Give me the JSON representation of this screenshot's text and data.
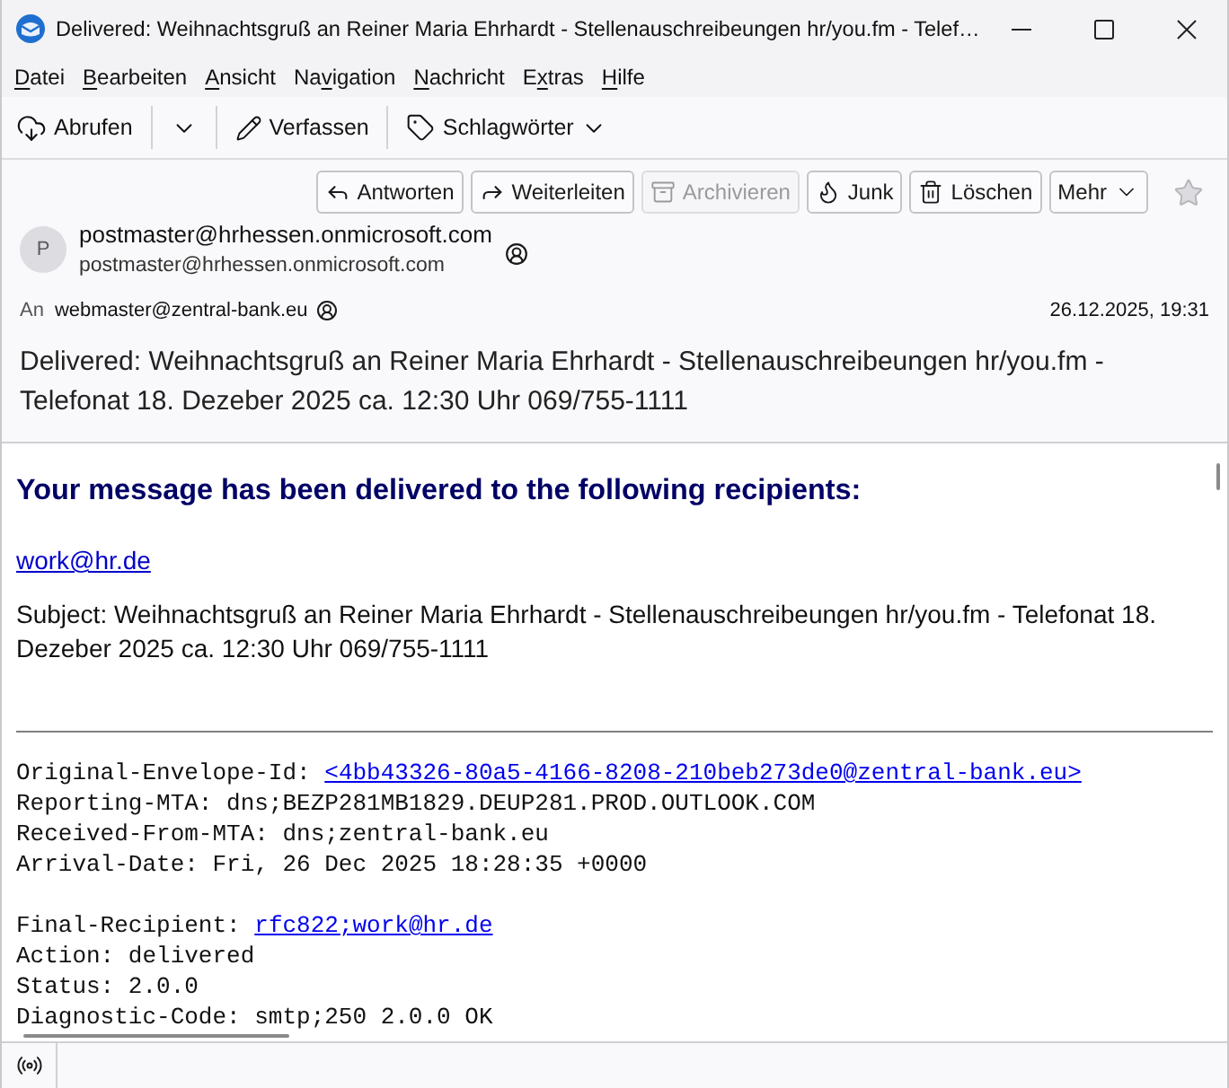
{
  "window": {
    "title": "Delivered: Weihnachtsgruß an Reiner Maria Ehrhardt - Stellenauschreibeungen hr/you.fm - Telef…"
  },
  "menu_bar": [
    {
      "key": "D",
      "post": "atei"
    },
    {
      "key": "B",
      "post": "earbeiten"
    },
    {
      "key": "A",
      "post": "nsicht"
    },
    {
      "pre": "Na",
      "key": "v",
      "post": "igation"
    },
    {
      "key": "N",
      "post": "achricht"
    },
    {
      "pre": "E",
      "key": "x",
      "post": "tras"
    },
    {
      "key": "H",
      "post": "ilfe"
    }
  ],
  "toolbar": [
    {
      "kind": "get",
      "label": "Abrufen"
    },
    {
      "kind": "compose",
      "label": "Verfassen"
    },
    {
      "kind": "tags",
      "label": "Schlagwörter"
    }
  ],
  "actions": [
    {
      "kind": "reply",
      "label": "Antworten",
      "disabled": false
    },
    {
      "kind": "forward",
      "label": "Weiterleiten",
      "disabled": false
    },
    {
      "kind": "archive",
      "label": "Archivieren",
      "disabled": true
    },
    {
      "kind": "junk",
      "label": "Junk",
      "disabled": false
    },
    {
      "kind": "delete",
      "label": "Löschen",
      "disabled": false
    },
    {
      "kind": "more",
      "label": "Mehr",
      "disabled": false
    }
  ],
  "message": {
    "starred": false,
    "sender": {
      "avatar": "P",
      "name": "postmaster@hrhessen.onmicrosoft.com",
      "email": "postmaster@hrhessen.onmicrosoft.com"
    },
    "to_label": "An",
    "to": "webmaster@zentral-bank.eu",
    "date": "26.12.2025, 19:31",
    "subject": "Delivered: Weihnachtsgruß an Reiner Maria Ehrhardt - Stellenauschreibeungen hr/you.fm - Telefonat 18. Dezeber 2025 ca. 12:30 Uhr 069/755-1111"
  },
  "body": {
    "heading": "Your message has been delivered to the following recipients:",
    "recipient_link": "work@hr.de",
    "subject_line": "Subject: Weihnachtsgruß an Reiner Maria Ehrhardt - Stellenauschreibeungen hr/you.fm - Telefonat 18. Dezeber 2025 ca. 12:30 Uhr 069/755-1111",
    "report_blocks": [
      [
        {
          "kind": "link",
          "label": "Original-Envelope-Id:",
          "link": "<4bb43326-80a5-4166-8208-210beb273de0@zentral-bank.eu>"
        },
        {
          "kind": "text",
          "text": "Reporting-MTA: dns;BEZP281MB1829.DEUP281.PROD.OUTLOOK.COM"
        },
        {
          "kind": "text",
          "text": "Received-From-MTA: dns;zentral-bank.eu"
        },
        {
          "kind": "text",
          "text": "Arrival-Date: Fri, 26 Dec 2025 18:28:35 +0000"
        }
      ],
      [
        {
          "kind": "link",
          "label": "Final-Recipient:",
          "link": "rfc822;work@hr.de"
        },
        {
          "kind": "text",
          "text": "Action: delivered"
        },
        {
          "kind": "text",
          "text": "Status: 2.0.0"
        },
        {
          "kind": "text",
          "text": "Diagnostic-Code: smtp;250 2.0.0 OK"
        }
      ]
    ]
  }
}
